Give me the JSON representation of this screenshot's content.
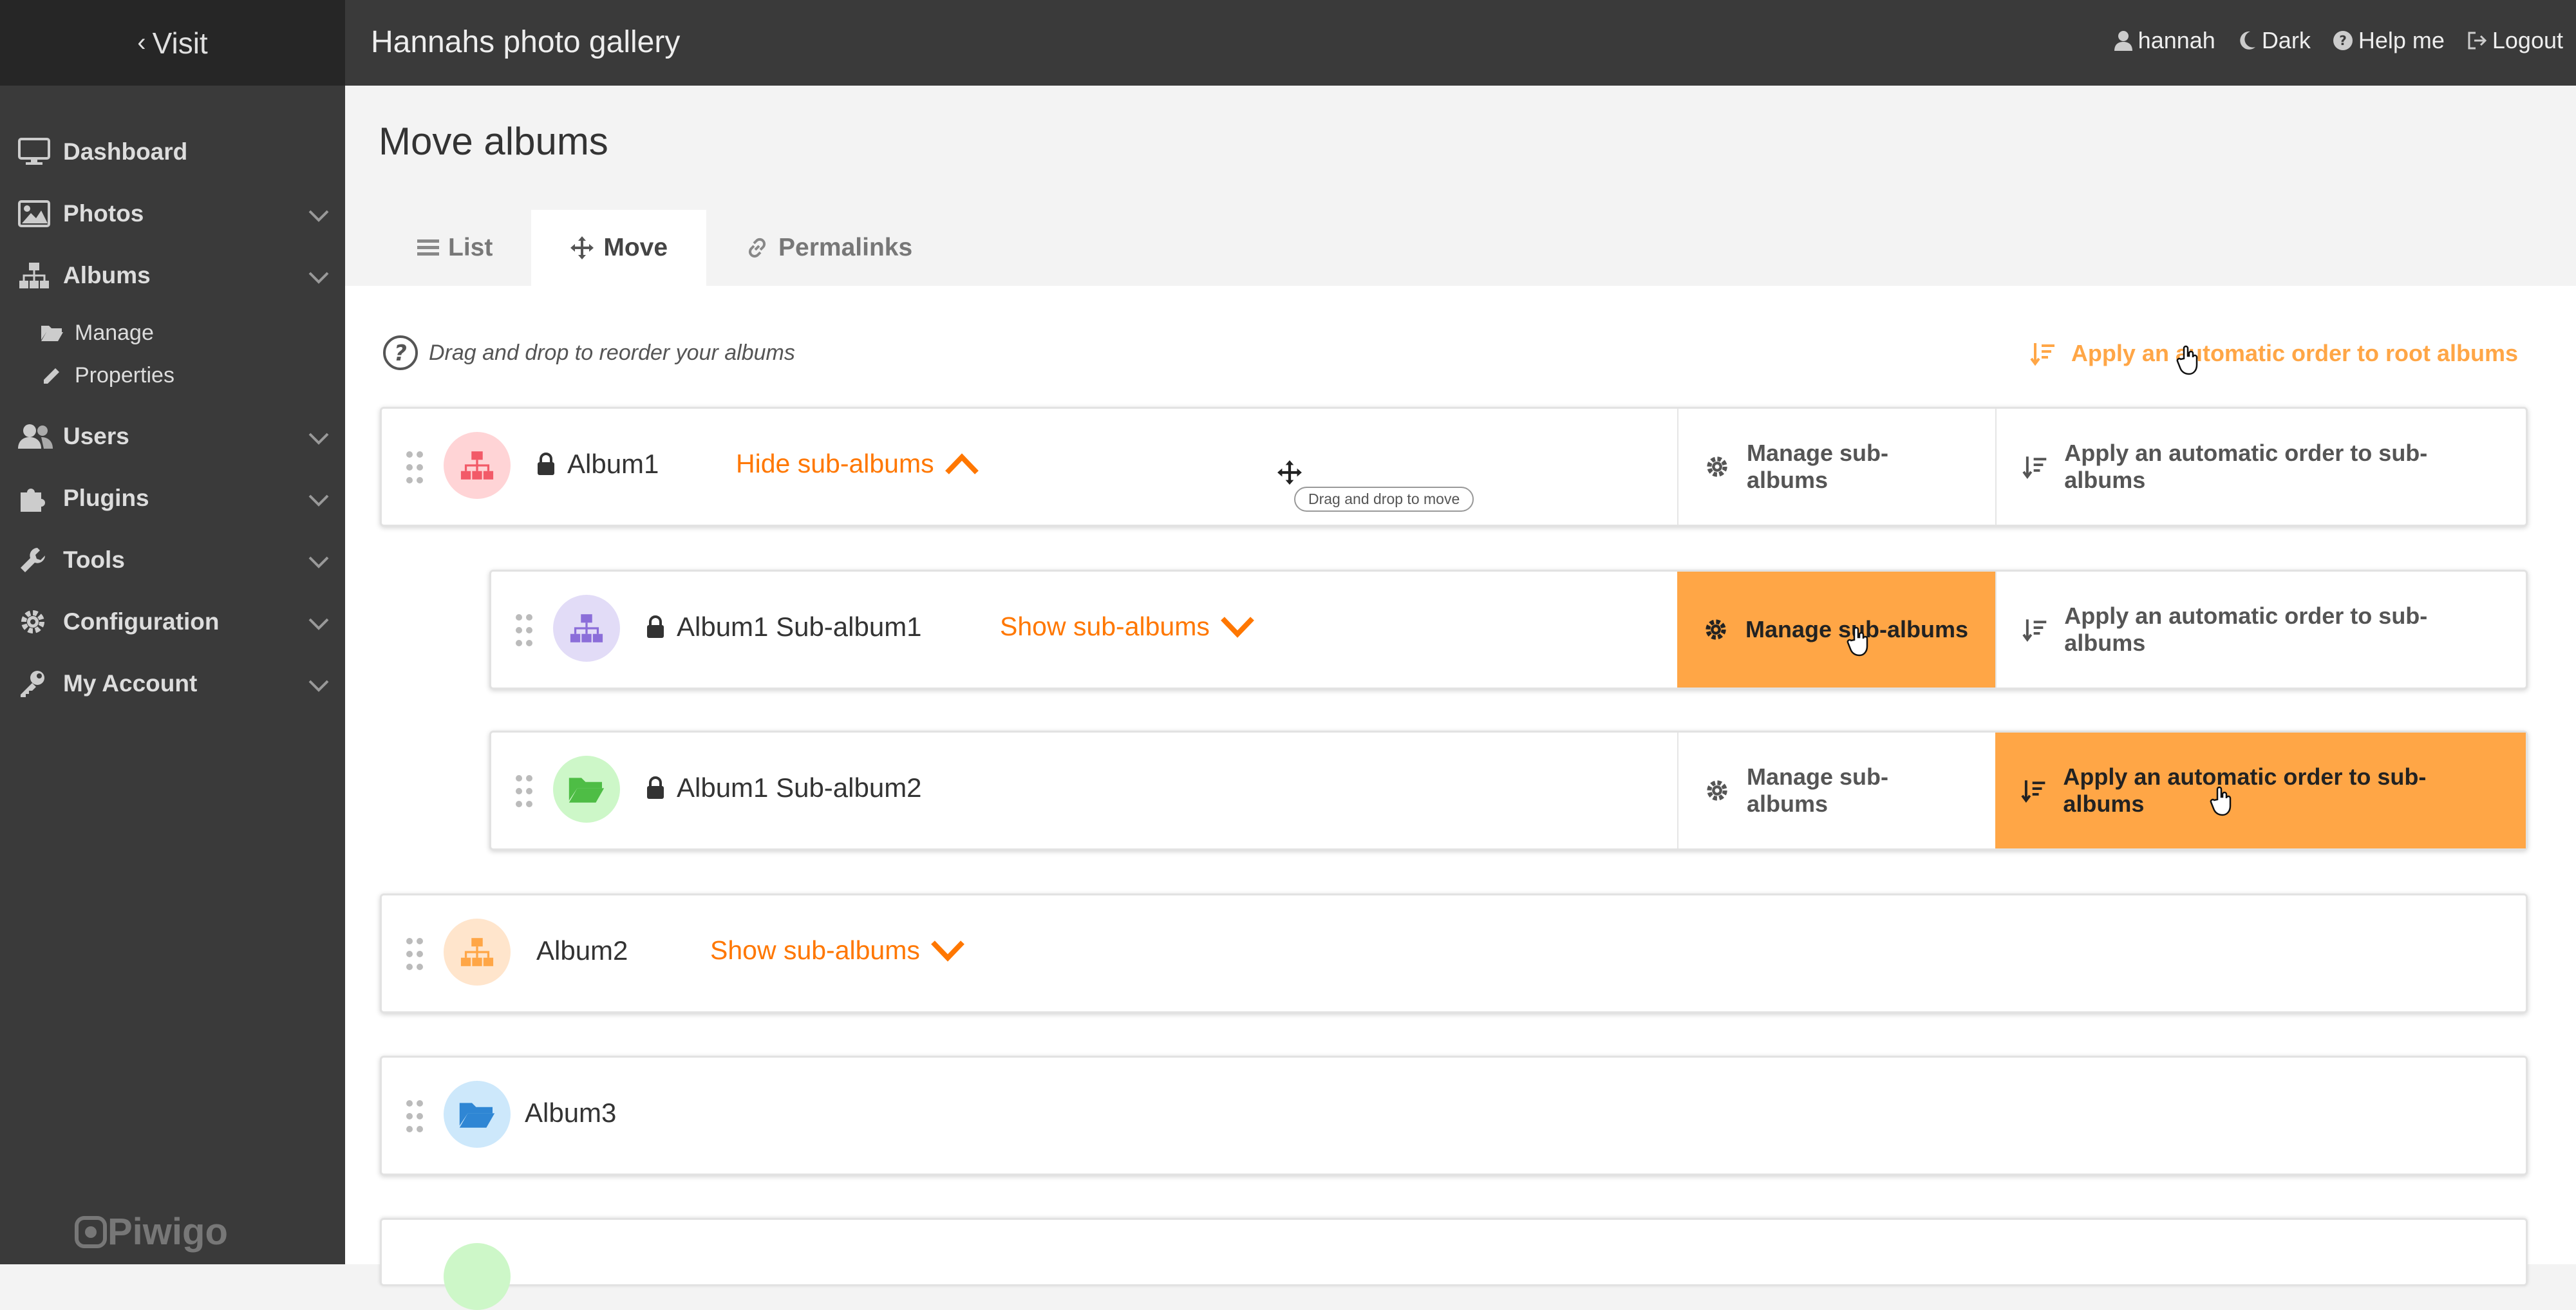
{
  "sidebar": {
    "visit_label": "Visit",
    "items": [
      {
        "label": "Dashboard",
        "icon": "monitor-icon"
      },
      {
        "label": "Photos",
        "icon": "image-icon"
      },
      {
        "label": "Albums",
        "icon": "sitemap-icon"
      },
      {
        "label": "Users",
        "icon": "users-icon"
      },
      {
        "label": "Plugins",
        "icon": "puzzle-icon"
      },
      {
        "label": "Tools",
        "icon": "wrench-icon"
      },
      {
        "label": "Configuration",
        "icon": "gear-icon"
      },
      {
        "label": "My Account",
        "icon": "key-icon"
      }
    ],
    "album_subitems": [
      {
        "label": "Manage",
        "icon": "folder-open-icon"
      },
      {
        "label": "Properties",
        "icon": "pencil-icon"
      }
    ],
    "brand": "Piwigo"
  },
  "header": {
    "site_title": "Hannahs photo gallery",
    "user": "hannah",
    "theme": "Dark",
    "help": "Help me",
    "logout": "Logout"
  },
  "page": {
    "title": "Move albums",
    "tabs": [
      {
        "label": "List",
        "icon": "list-icon"
      },
      {
        "label": "Move",
        "icon": "move-icon",
        "active": true
      },
      {
        "label": "Permalinks",
        "icon": "link-icon"
      }
    ],
    "help_text": "Drag and drop to reorder your albums",
    "root_order_label": "Apply an automatic order to root albums",
    "tooltip": "Drag and drop to move"
  },
  "albums": [
    {
      "name": "Album1",
      "locked": true,
      "toggle": "Hide sub-albums",
      "manage": "Manage sub-albums",
      "order": "Apply an automatic order to sub-albums"
    },
    {
      "name": "Album1 Sub-album1",
      "locked": true,
      "toggle": "Show sub-albums",
      "manage": "Manage sub-albums",
      "order": "Apply an automatic order to sub-albums"
    },
    {
      "name": "Album1 Sub-album2",
      "locked": true,
      "manage": "Manage sub-albums",
      "order": "Apply an automatic order to sub-albums"
    },
    {
      "name": "Album2",
      "locked": false,
      "toggle": "Show sub-albums"
    },
    {
      "name": "Album3",
      "locked": false
    }
  ],
  "colors": {
    "accent": "#ffa646",
    "toggle": "#ff7700",
    "sidebar": "#3a3a3a"
  }
}
